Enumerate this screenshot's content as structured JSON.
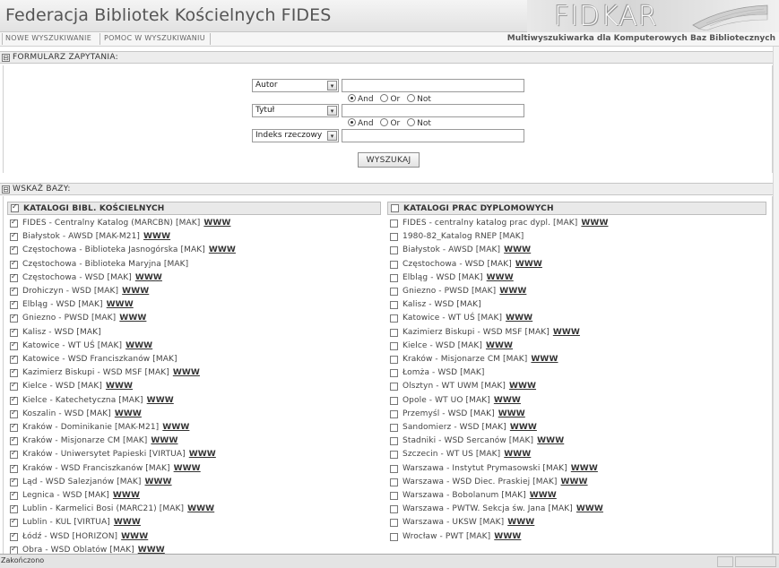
{
  "header": {
    "title": "Federacja Bibliotek Kościelnych FIDES",
    "logo_text": "FIDKAR"
  },
  "nav": {
    "new_search": "Nowe wyszukiwanie",
    "search_help": "Pomoc w wyszukiwaniu",
    "tagline": "Multiwyszukiwarka dla Komputerowych Baz Bibliotecznych"
  },
  "query_form": {
    "section_title": "FORMULARZ ZAPYTANIA:",
    "toggle_symbol": "⊟",
    "arrow_symbol": "▾",
    "fields": [
      {
        "select": "Autor",
        "value": ""
      },
      {
        "select": "Tytuł",
        "value": ""
      },
      {
        "select": "Indeks rzeczowy",
        "value": ""
      }
    ],
    "operators": [
      "And",
      "Or",
      "Not"
    ],
    "selected_operator": "And",
    "search_button": "WYSZUKAJ"
  },
  "databases": {
    "section_title": "WSKAŻ BAZY:",
    "toggle_symbol": "⊟",
    "www_label": "WWW",
    "church_catalogs": {
      "title": "KATALOGI BIBL. KOŚCIELNYCH",
      "header_checked": true,
      "items": [
        {
          "label": "FIDES - Centralny Katalog (MARCBN) [MAK]",
          "www": true,
          "checked": true
        },
        {
          "label": "Białystok - AWSD [MAK-M21]",
          "www": true,
          "checked": true
        },
        {
          "label": "Częstochowa - Biblioteka Jasnogórska [MAK]",
          "www": true,
          "checked": true
        },
        {
          "label": "Częstochowa - Biblioteka Maryjna [MAK]",
          "www": false,
          "checked": true
        },
        {
          "label": "Częstochowa - WSD [MAK]",
          "www": true,
          "checked": true
        },
        {
          "label": "Drohiczyn - WSD [MAK]",
          "www": true,
          "checked": true
        },
        {
          "label": "Elbląg - WSD [MAK]",
          "www": true,
          "checked": true
        },
        {
          "label": "Gniezno - PWSD [MAK]",
          "www": true,
          "checked": true
        },
        {
          "label": "Kalisz - WSD [MAK]",
          "www": false,
          "checked": true
        },
        {
          "label": "Katowice - WT UŚ [MAK]",
          "www": true,
          "checked": true
        },
        {
          "label": "Katowice - WSD Franciszkanów [MAK]",
          "www": false,
          "checked": true
        },
        {
          "label": "Kazimierz Biskupi - WSD MSF [MAK]",
          "www": true,
          "checked": true
        },
        {
          "label": "Kielce - WSD [MAK]",
          "www": true,
          "checked": true
        },
        {
          "label": "Kielce - Katechetyczna [MAK]",
          "www": true,
          "checked": true
        },
        {
          "label": "Koszalin - WSD [MAK]",
          "www": true,
          "checked": true
        },
        {
          "label": "Kraków - Dominikanie [MAK-M21]",
          "www": true,
          "checked": true
        },
        {
          "label": "Kraków - Misjonarze CM [MAK]",
          "www": true,
          "checked": true
        },
        {
          "label": "Kraków - Uniwersytet Papieski [VIRTUA]",
          "www": true,
          "checked": true
        },
        {
          "label": "Kraków - WSD Franciszkanów [MAK]",
          "www": true,
          "checked": true
        },
        {
          "label": "Ląd - WSD Salezjanów [MAK]",
          "www": true,
          "checked": true
        },
        {
          "label": "Legnica - WSD [MAK]",
          "www": true,
          "checked": true
        },
        {
          "label": "Lublin - Karmelici Bosi (MARC21) [MAK]",
          "www": true,
          "checked": true
        },
        {
          "label": "Lublin - KUL [VIRTUA]",
          "www": true,
          "checked": true
        },
        {
          "label": "Łódź - WSD [HORIZON]",
          "www": true,
          "checked": true
        },
        {
          "label": "Obra - WSD Oblatów [MAK]",
          "www": true,
          "checked": true
        }
      ]
    },
    "thesis_catalogs": {
      "title": "KATALOGI PRAC DYPLOMOWYCH",
      "header_checked": false,
      "items": [
        {
          "label": "FIDES - centralny katalog prac dypl. [MAK]",
          "www": true,
          "checked": false
        },
        {
          "label": "1980-82_Katalog RNEP [MAK]",
          "www": false,
          "checked": false
        },
        {
          "label": "Białystok - AWSD [MAK]",
          "www": true,
          "checked": false
        },
        {
          "label": "Częstochowa - WSD [MAK]",
          "www": true,
          "checked": false
        },
        {
          "label": "Elbląg - WSD [MAK]",
          "www": true,
          "checked": false
        },
        {
          "label": "Gniezno - PWSD [MAK]",
          "www": true,
          "checked": false
        },
        {
          "label": "Kalisz - WSD [MAK]",
          "www": false,
          "checked": false
        },
        {
          "label": "Katowice - WT UŚ [MAK]",
          "www": true,
          "checked": false
        },
        {
          "label": "Kazimierz Biskupi - WSD MSF [MAK]",
          "www": true,
          "checked": false
        },
        {
          "label": "Kielce - WSD [MAK]",
          "www": true,
          "checked": false
        },
        {
          "label": "Kraków - Misjonarze CM [MAK]",
          "www": true,
          "checked": false
        },
        {
          "label": "Łomża - WSD [MAK]",
          "www": false,
          "checked": false
        },
        {
          "label": "Olsztyn - WT UWM [MAK]",
          "www": true,
          "checked": false
        },
        {
          "label": "Opole - WT UO [MAK]",
          "www": true,
          "checked": false
        },
        {
          "label": "Przemyśl - WSD [MAK]",
          "www": true,
          "checked": false
        },
        {
          "label": "Sandomierz - WSD [MAK]",
          "www": true,
          "checked": false
        },
        {
          "label": "Stadniki - WSD Sercanów [MAK]",
          "www": true,
          "checked": false
        },
        {
          "label": "Szczecin - WT US [MAK]",
          "www": true,
          "checked": false
        },
        {
          "label": "Warszawa - Instytut Prymasowski [MAK]",
          "www": true,
          "checked": false
        },
        {
          "label": "Warszawa - WSD Diec. Praskiej [MAK]",
          "www": true,
          "checked": false
        },
        {
          "label": "Warszawa - Bobolanum [MAK]",
          "www": true,
          "checked": false
        },
        {
          "label": "Warszawa - PWTW. Sekcja św. Jana [MAK]",
          "www": true,
          "checked": false
        },
        {
          "label": "Warszawa - UKSW [MAK]",
          "www": true,
          "checked": false
        },
        {
          "label": "Wrocław - PWT [MAK]",
          "www": true,
          "checked": false
        }
      ]
    }
  },
  "status": {
    "text": "Zakończono"
  }
}
